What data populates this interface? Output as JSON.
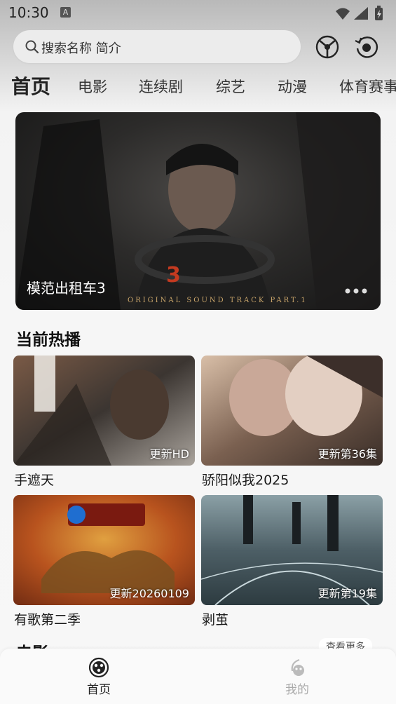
{
  "status": {
    "time": "10:30",
    "notification_badge": "A"
  },
  "search": {
    "placeholder": "搜索名称 简介"
  },
  "tabs": [
    {
      "label": "首页",
      "active": true
    },
    {
      "label": "电影"
    },
    {
      "label": "连续剧"
    },
    {
      "label": "综艺"
    },
    {
      "label": "动漫"
    },
    {
      "label": "体育赛事"
    }
  ],
  "banner": {
    "title": "模范出租车3",
    "subtitle": "ORIGINAL SOUND TRACK PART.1",
    "logo_text": "3"
  },
  "hot_section": {
    "title": "当前热播"
  },
  "cards": [
    {
      "title": "手遮天",
      "badge": "更新HD",
      "thumb_colors": [
        "#7a5a46",
        "#3b3531",
        "#a9a39c"
      ]
    },
    {
      "title": "骄阳似我2025",
      "badge": "更新第36集",
      "thumb_colors": [
        "#d9bfa8",
        "#7a6050",
        "#3a2e28"
      ]
    },
    {
      "title": "有歌第二季",
      "badge": "更新20260109",
      "thumb_colors": [
        "#6e2a12",
        "#b8531e",
        "#e0a040"
      ]
    },
    {
      "title": "剥茧",
      "badge": "更新第19集",
      "thumb_colors": [
        "#4d5f66",
        "#2d3b40",
        "#8ba0a6"
      ]
    }
  ],
  "next_section": {
    "title": "电影",
    "more_label": "查看更多"
  },
  "bottom_nav": [
    {
      "label": "首页",
      "active": true
    },
    {
      "label": "我的",
      "active": false
    }
  ],
  "colors": {
    "active_tab": "#222222",
    "inactive_nav": "#aaaaaa",
    "accent_gold": "#c8a46a"
  }
}
